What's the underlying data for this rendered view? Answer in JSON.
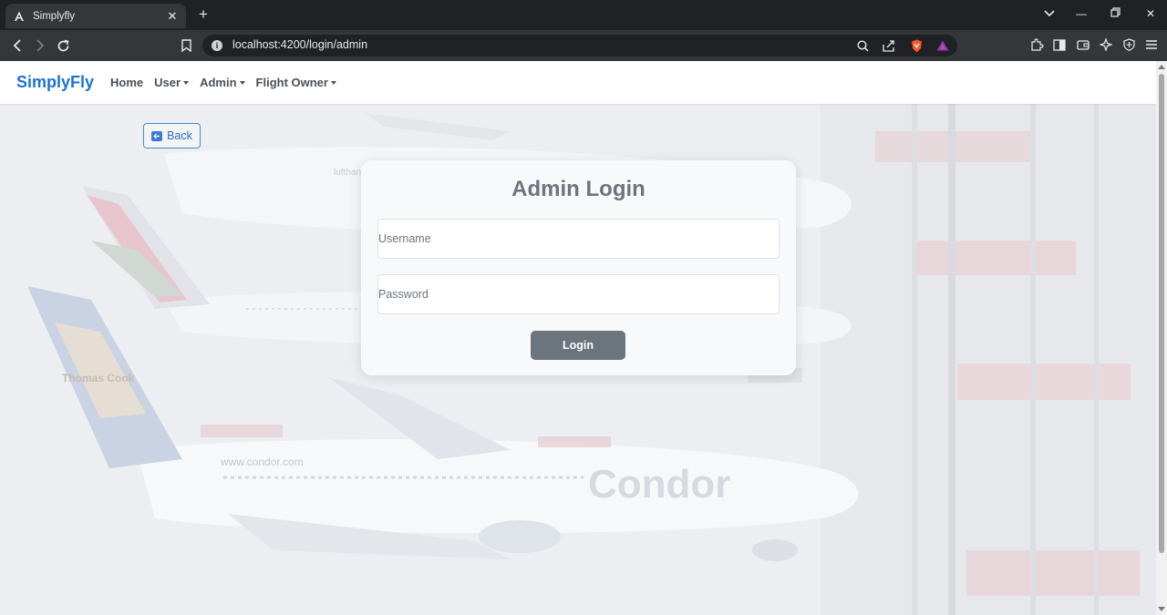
{
  "browser": {
    "tab_title": "Simplyfly",
    "url": "localhost:4200/login/admin"
  },
  "navbar": {
    "brand": "SimplyFly",
    "links": [
      {
        "label": "Home",
        "dropdown": false
      },
      {
        "label": "User",
        "dropdown": true
      },
      {
        "label": "Admin",
        "dropdown": true
      },
      {
        "label": "Flight Owner",
        "dropdown": true
      }
    ]
  },
  "back_button": {
    "label": "Back"
  },
  "login_card": {
    "title": "Admin Login",
    "username_placeholder": "Username",
    "password_placeholder": "Password",
    "submit_label": "Login"
  },
  "background": {
    "airline_texts": [
      "Condor",
      "www.condor.com",
      "Thomas Cook",
      "lufthansa"
    ]
  },
  "colors": {
    "brand": "#1a73d4",
    "button": "#6c757d",
    "heading": "#6c757d"
  }
}
